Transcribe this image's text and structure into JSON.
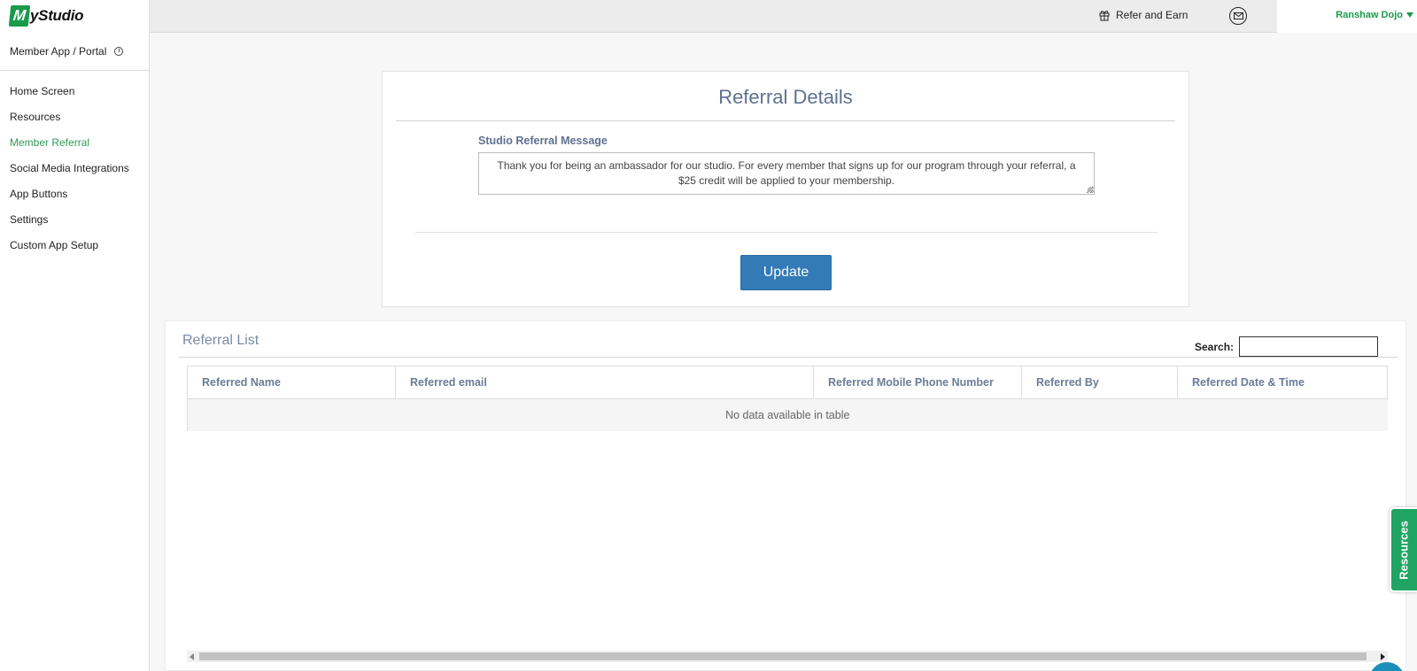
{
  "header": {
    "logo_mark": "M",
    "logo_text": "yStudio",
    "refer_label": "Refer and Earn",
    "user_name": "Ranshaw Dojo"
  },
  "sidebar": {
    "section_title": "Member App / Portal",
    "items": [
      {
        "label": "Home Screen",
        "active": false
      },
      {
        "label": "Resources",
        "active": false
      },
      {
        "label": "Member Referral",
        "active": true
      },
      {
        "label": "Social Media Integrations",
        "active": false
      },
      {
        "label": "App Buttons",
        "active": false
      },
      {
        "label": "Settings",
        "active": false
      },
      {
        "label": "Custom App Setup",
        "active": false
      }
    ]
  },
  "details": {
    "title": "Referral Details",
    "message_label": "Studio Referral Message",
    "message_value": "Thank you for being an ambassador for our studio. For every member that signs up for our program through your referral, a $25 credit will be applied to your membership.",
    "update_label": "Update"
  },
  "list": {
    "title": "Referral List",
    "search_label": "Search:",
    "search_value": "",
    "columns": [
      "Referred Name",
      "Referred email",
      "Referred Mobile Phone Number",
      "Referred By",
      "Referred Date & Time"
    ],
    "empty_message": "No data available in table"
  },
  "resources_tab": "Resources",
  "colors": {
    "brand_green": "#1a9a4a",
    "button_blue": "#337ab7",
    "heading_slate": "#5e7190"
  }
}
